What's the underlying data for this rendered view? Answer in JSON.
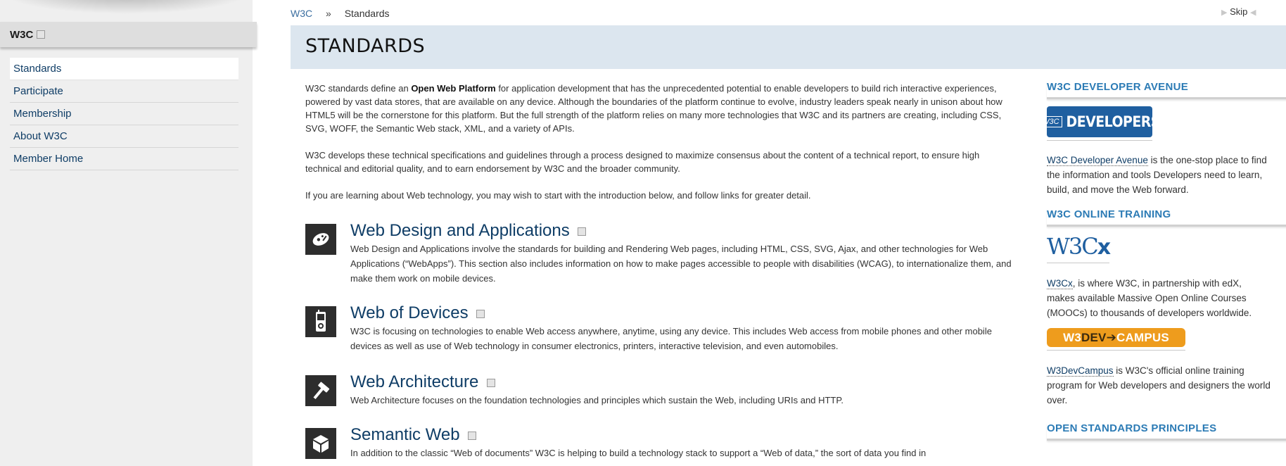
{
  "sidebar": {
    "heading": "W3C",
    "items": [
      {
        "label": "Standards"
      },
      {
        "label": "Participate"
      },
      {
        "label": "Membership"
      },
      {
        "label": "About W3C"
      },
      {
        "label": "Member Home"
      }
    ]
  },
  "breadcrumb": {
    "home": "W3C",
    "separator": "»",
    "current": "Standards"
  },
  "skip_label": "Skip",
  "page_title": "STANDARDS",
  "intro": {
    "p1_before": "W3C standards define an ",
    "p1_bold": "Open Web Platform",
    "p1_after": " for application development that has the unprecedented potential to enable developers to build rich interactive experiences, powered by vast data stores, that are available on any device. Although the boundaries of the platform continue to evolve, industry leaders speak nearly in unison about how HTML5 will be the cornerstone for this platform. But the full strength of the platform relies on many more technologies that W3C and its partners are creating, including CSS, SVG, WOFF, the Semantic Web stack, XML, and a variety of APIs.",
    "p2": "W3C develops these technical specifications and guidelines through a process designed to maximize consensus about the content of a technical report, to ensure high technical and editorial quality, and to earn endorsement by W3C and the broader community.",
    "p3": "If you are learning about Web technology, you may wish to start with the introduction below, and follow links for greater detail."
  },
  "sections": [
    {
      "title": "Web Design and Applications",
      "icon": "palette-icon",
      "desc": "Web Design and Applications involve the standards for building and Rendering Web pages, including HTML, CSS, SVG, Ajax, and other technologies for Web Applications (“WebApps”). This section also includes information on how to make pages accessible to people with disabilities (WCAG), to internationalize them, and make them work on mobile devices."
    },
    {
      "title": "Web of Devices",
      "icon": "mobile-device-icon",
      "desc": "W3C is focusing on technologies to enable Web access anywhere, anytime, using any device. This includes Web access from mobile phones and other mobile devices as well as use of Web technology in consumer electronics, printers, interactive television, and even automobiles."
    },
    {
      "title": "Web Architecture",
      "icon": "hammer-icon",
      "desc": "Web Architecture focuses on the foundation technologies and principles which sustain the Web, including URIs and HTTP."
    },
    {
      "title": "Semantic Web",
      "icon": "cube-icon",
      "desc": "In addition to the classic “Web of documents” W3C is helping to build a technology stack to support a “Web of data,” the sort of data you find in"
    }
  ],
  "aside": {
    "developer_avenue": {
      "heading": "W3C DEVELOPER AVENUE",
      "logo_badge": "W3C",
      "logo_text": "DEVELOPERS",
      "link": "W3C Developer Avenue",
      "text": " is the one-stop place to find the information and tools Developers need to learn, build, and move the Web forward."
    },
    "online_training": {
      "heading": "W3C ONLINE TRAINING",
      "w3cx_logo": "W3C",
      "w3cx_logo_x": "x",
      "w3cx_link": "W3Cx",
      "w3cx_text": ", is where W3C, in partnership with edX, makes available Massive Open Online Courses (MOOCs) to thousands of developers worldwide.",
      "campus_logo_a": "W3",
      "campus_logo_b": "DEV",
      "campus_logo_c": "➔",
      "campus_logo_d": "CAMPUS",
      "campus_link": "W3DevCampus",
      "campus_text": " is W3C's official online training program for Web developers and designers the world over."
    },
    "principles": {
      "heading": "OPEN STANDARDS PRINCIPLES"
    }
  }
}
